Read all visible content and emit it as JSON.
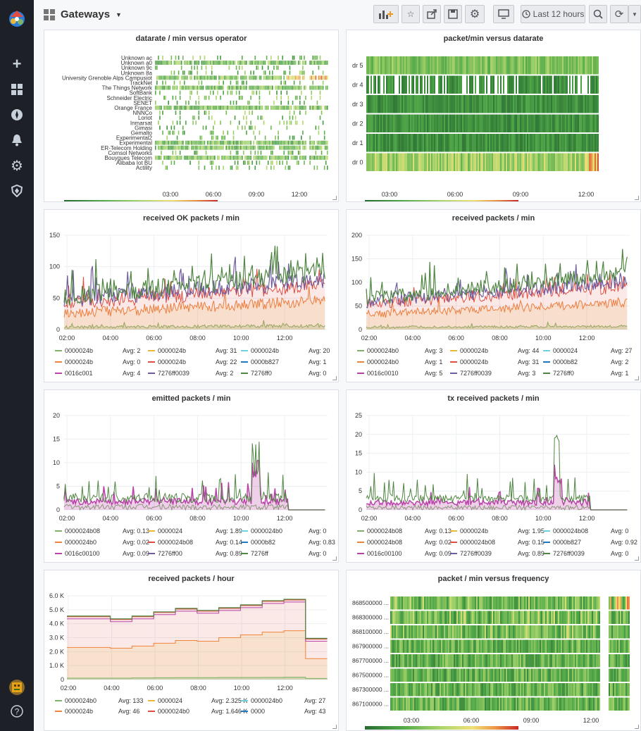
{
  "header": {
    "title": "Gateways",
    "time_range": "Last 12 hours"
  },
  "icons": {
    "logo": "grafana-logo-icon",
    "caret": "caret-down-icon",
    "add": "plus-icon",
    "dash": "dashboards-icon",
    "explore": "compass-icon",
    "alert": "bell-icon",
    "config": "gear-icon",
    "admin": "shield-icon",
    "avatar": "avatar-icon",
    "help": "help-icon",
    "grid": "grid-icon"
  },
  "colors": {
    "green": "#7eb26d",
    "yellow": "#eab839",
    "cyan": "#6ed0e0",
    "orange": "#ef843c",
    "red": "#e24d42",
    "blue": "#1f78c1",
    "purple": "#ba43a9",
    "violet": "#705da0",
    "dkgreen": "#508642"
  },
  "chart_data": [
    {
      "type": "heatmap",
      "title": "datarate / min versus operator",
      "x_ticks": [
        "03:00",
        "06:00",
        "09:00",
        "12:00"
      ],
      "categories": [
        "Unknown ac",
        "Unknown a0",
        "Unknown 9c",
        "Unknown 8a",
        "University Grenoble Alps Campusiot",
        "TrackNet",
        "The Things Network",
        "SoftBank",
        "Schneider Electric",
        "SENET",
        "Orange France",
        "NNNCo",
        "Loriot",
        "Inmarsat",
        "Gimasi",
        "Gemalto",
        "Experimental2",
        "Experimental",
        "ER-Telecom Holding",
        "Comsol Networks",
        "Bouygues Telecom",
        "Alibaba Iot BU",
        "Actility"
      ],
      "scale": [
        "1",
        "20",
        "40",
        "58"
      ]
    },
    {
      "type": "heatmap",
      "title": "packet/min versus datarate",
      "x_ticks": [
        "03:00",
        "06:00",
        "09:00",
        "12:00"
      ],
      "categories": [
        "dr 5",
        "dr 4",
        "dr 3",
        "dr 2",
        "dr 1",
        "dr 0"
      ],
      "scale": [
        "0",
        "20",
        "40",
        "60",
        "73"
      ]
    },
    {
      "type": "area",
      "title": "received OK packets / min",
      "y_ticks": [
        "150",
        "100",
        "50",
        "0"
      ],
      "ylim": [
        0,
        150
      ],
      "x_ticks": [
        "02:00",
        "04:00",
        "06:00",
        "08:00",
        "10:00",
        "12:00"
      ],
      "legend": [
        {
          "name": "0000024b",
          "avg": "Avg: 2",
          "color": "#7eb26d"
        },
        {
          "name": "0000024b",
          "avg": "Avg: 31",
          "color": "#eab839"
        },
        {
          "name": "0000024b",
          "avg": "Avg: 20",
          "color": "#6ed0e0"
        },
        {
          "name": "0000024b",
          "avg": "Avg: 0",
          "color": "#ef843c"
        },
        {
          "name": "0000024b",
          "avg": "Avg: 22",
          "color": "#e24d42"
        },
        {
          "name": "0000b827",
          "avg": "Avg: 1",
          "color": "#1f78c1"
        },
        {
          "name": "0016c001",
          "avg": "Avg: 4",
          "color": "#ba43a9"
        },
        {
          "name": "7276ff0039",
          "avg": "Avg: 2",
          "color": "#705da0"
        },
        {
          "name": "7276ff0",
          "avg": "Avg: 0",
          "color": "#508642"
        }
      ]
    },
    {
      "type": "area",
      "title": "received packets / min",
      "y_ticks": [
        "200",
        "150",
        "100",
        "50",
        "0"
      ],
      "ylim": [
        0,
        200
      ],
      "x_ticks": [
        "02:00",
        "04:00",
        "06:00",
        "08:00",
        "10:00",
        "12:00"
      ],
      "legend": [
        {
          "name": "0000024b0",
          "avg": "Avg: 3",
          "color": "#7eb26d"
        },
        {
          "name": "0000024b",
          "avg": "Avg: 44",
          "color": "#eab839"
        },
        {
          "name": "0000024",
          "avg": "Avg: 27",
          "color": "#6ed0e0"
        },
        {
          "name": "0000024b0",
          "avg": "Avg: 1",
          "color": "#ef843c"
        },
        {
          "name": "0000024b",
          "avg": "Avg: 31",
          "color": "#e24d42"
        },
        {
          "name": "0000b82",
          "avg": "Avg: 2",
          "color": "#1f78c1"
        },
        {
          "name": "0016c0010",
          "avg": "Avg: 5",
          "color": "#ba43a9"
        },
        {
          "name": "7276ff0039",
          "avg": "Avg: 3",
          "color": "#705da0"
        },
        {
          "name": "7276ff0",
          "avg": "Avg: 1",
          "color": "#508642"
        }
      ]
    },
    {
      "type": "area",
      "title": "emitted packets / min",
      "y_ticks": [
        "20",
        "15",
        "10",
        "5",
        "0"
      ],
      "ylim": [
        0,
        20
      ],
      "x_ticks": [
        "02:00",
        "04:00",
        "06:00",
        "08:00",
        "10:00",
        "12:00"
      ],
      "legend": [
        {
          "name": "0000024b08",
          "avg": "Avg: 0.13",
          "color": "#7eb26d"
        },
        {
          "name": "0000024",
          "avg": "Avg: 1.89",
          "color": "#eab839"
        },
        {
          "name": "0000024b0",
          "avg": "Avg: 0",
          "color": "#6ed0e0"
        },
        {
          "name": "0000024b0",
          "avg": "Avg: 0.02",
          "color": "#ef843c"
        },
        {
          "name": "0000024b08",
          "avg": "Avg: 0.14",
          "color": "#e24d42"
        },
        {
          "name": "0000b82",
          "avg": "Avg: 0.83",
          "color": "#1f78c1"
        },
        {
          "name": "0016c00100",
          "avg": "Avg: 0.09",
          "color": "#ba43a9"
        },
        {
          "name": "7276ff00",
          "avg": "Avg: 0.89",
          "color": "#705da0"
        },
        {
          "name": "7276ff",
          "avg": "Avg: 0",
          "color": "#508642"
        }
      ]
    },
    {
      "type": "area",
      "title": "tx received packets / min",
      "y_ticks": [
        "25",
        "20",
        "15",
        "10",
        "5",
        "0"
      ],
      "ylim": [
        0,
        25
      ],
      "x_ticks": [
        "02:00",
        "04:00",
        "06:00",
        "08:00",
        "10:00",
        "12:00"
      ],
      "legend": [
        {
          "name": "0000024b08",
          "avg": "Avg: 0.13",
          "color": "#7eb26d"
        },
        {
          "name": "0000024b",
          "avg": "Avg: 1.95",
          "color": "#eab839"
        },
        {
          "name": "0000024b08",
          "avg": "Avg: 0",
          "color": "#6ed0e0"
        },
        {
          "name": "0000024b08",
          "avg": "Avg: 0.02",
          "color": "#ef843c"
        },
        {
          "name": "0000024b08",
          "avg": "Avg: 0.15",
          "color": "#e24d42"
        },
        {
          "name": "0000b827",
          "avg": "Avg: 0.92",
          "color": "#1f78c1"
        },
        {
          "name": "0016c00100",
          "avg": "Avg: 0.09",
          "color": "#ba43a9"
        },
        {
          "name": "7276ff0039",
          "avg": "Avg: 0.89",
          "color": "#705da0"
        },
        {
          "name": "7276ff0039",
          "avg": "Avg: 0",
          "color": "#508642"
        }
      ]
    },
    {
      "type": "area",
      "title": "received packets / hour",
      "y_ticks": [
        "6.0 K",
        "5.0 K",
        "4.0 K",
        "3.0 K",
        "2.0 K",
        "1.0 K",
        "0"
      ],
      "ylim": [
        0,
        6000
      ],
      "x_ticks": [
        "02:00",
        "04:00",
        "06:00",
        "08:00",
        "10:00",
        "12:00"
      ],
      "legend": [
        {
          "name": "0000024b0",
          "avg": "Avg: 133",
          "color": "#7eb26d"
        },
        {
          "name": "0000024",
          "avg": "Avg: 2.325 K",
          "color": "#eab839"
        },
        {
          "name": "0000024b0",
          "avg": "Avg: 27",
          "color": "#6ed0e0"
        },
        {
          "name": "0000024b",
          "avg": "Avg: 46",
          "color": "#ef843c"
        },
        {
          "name": "0000024b0",
          "avg": "Avg: 1.646 K",
          "color": "#e24d42"
        },
        {
          "name": "0000",
          "avg": "Avg: 43",
          "color": "#1f78c1"
        }
      ]
    },
    {
      "type": "heatmap",
      "title": "packet / min versus frequency",
      "x_ticks": [
        "03:00",
        "06:00",
        "09:00",
        "12:00"
      ],
      "categories": [
        "868500000 ...",
        "868300000 ...",
        "868100000 ...",
        "867900000 ...",
        "867700000 ...",
        "867500000 ...",
        "867300000 ...",
        "867100000 ..."
      ]
    }
  ]
}
